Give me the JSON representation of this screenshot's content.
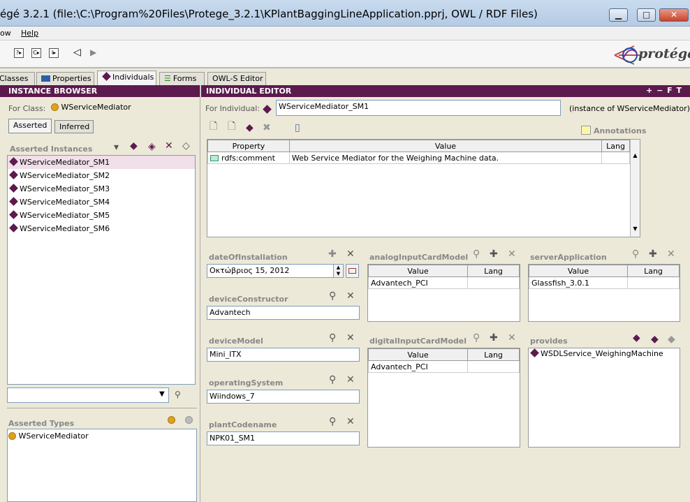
{
  "window": {
    "title": "égé 3.2.1    (file:\\C:\\Program%20Files\\Protege_3.2.1\\KPlantBaggingLineApplication.pprj, OWL / RDF Files)",
    "min": "▁",
    "max": "□",
    "close": "✕"
  },
  "menu": {
    "items": [
      "ow",
      "Help"
    ]
  },
  "toolbar": {
    "icons": [
      "?▸",
      "C▸",
      "I▸"
    ],
    "back": "◁",
    "forward": "▶"
  },
  "logo": {
    "text": "protégé"
  },
  "tabs": [
    {
      "label": "Classes"
    },
    {
      "label": "Properties"
    },
    {
      "label": "Individuals"
    },
    {
      "label": "Forms"
    },
    {
      "label": "OWL-S Editor"
    }
  ],
  "instance_browser": {
    "header": "INSTANCE BROWSER",
    "for_class_label": "For Class:",
    "for_class_value": "WServiceMediator",
    "subtabs": [
      "Asserted",
      "Inferred"
    ],
    "asserted_instances_label": "Asserted Instances",
    "instances": [
      "WServiceMediator_SM1",
      "WServiceMediator_SM2",
      "WServiceMediator_SM3",
      "WServiceMediator_SM4",
      "WServiceMediator_SM5",
      "WServiceMediator_SM6"
    ],
    "asserted_types_label": "Asserted Types",
    "types": [
      "WServiceMediator"
    ]
  },
  "individual_editor": {
    "header": "INDIVIDUAL EDITOR",
    "header_icons": "+ − F T",
    "for_individual_label": "For Individual:",
    "individual_name": "WServiceMediator_SM1",
    "instance_of": "(instance of WServiceMediator)",
    "annotations_label": "Annotations",
    "annotations_table": {
      "headers": [
        "Property",
        "Value",
        "Lang"
      ],
      "rows": [
        {
          "property": "rdfs:comment",
          "value": "Web Service Mediator for the Weighing Machine data.",
          "lang": ""
        }
      ]
    },
    "widgets": {
      "dateOfInstallation": {
        "label": "dateOfInstallation",
        "value": "Οκτώβριος 15, 2012"
      },
      "deviceConstructor": {
        "label": "deviceConstructor",
        "value": "Advantech"
      },
      "deviceModel": {
        "label": "deviceModel",
        "value": "Mini_ITX"
      },
      "operatingSystem": {
        "label": "operatingSystem",
        "value": "Wiindows_7"
      },
      "plantCodename": {
        "label": "plantCodename",
        "value": "NPK01_SM1"
      },
      "analogInputCardModel": {
        "label": "analogInputCardModel",
        "headers": [
          "Value",
          "Lang"
        ],
        "rows": [
          [
            "Advantech_PCI",
            ""
          ]
        ]
      },
      "digitalInputCardModel": {
        "label": "digitalInputCardModel",
        "headers": [
          "Value",
          "Lang"
        ],
        "rows": [
          [
            "Advantech_PCI",
            ""
          ]
        ]
      },
      "serverApplication": {
        "label": "serverApplication",
        "headers": [
          "Value",
          "Lang"
        ],
        "rows": [
          [
            "Glassfish_3.0.1",
            ""
          ]
        ]
      },
      "provides": {
        "label": "provides",
        "items": [
          "WSDLService_WeighingMachine"
        ]
      }
    }
  },
  "colors": {
    "header_bg": "#5c1a4e",
    "selection": "#f1dfe9",
    "class_dot": "#e0a020"
  }
}
